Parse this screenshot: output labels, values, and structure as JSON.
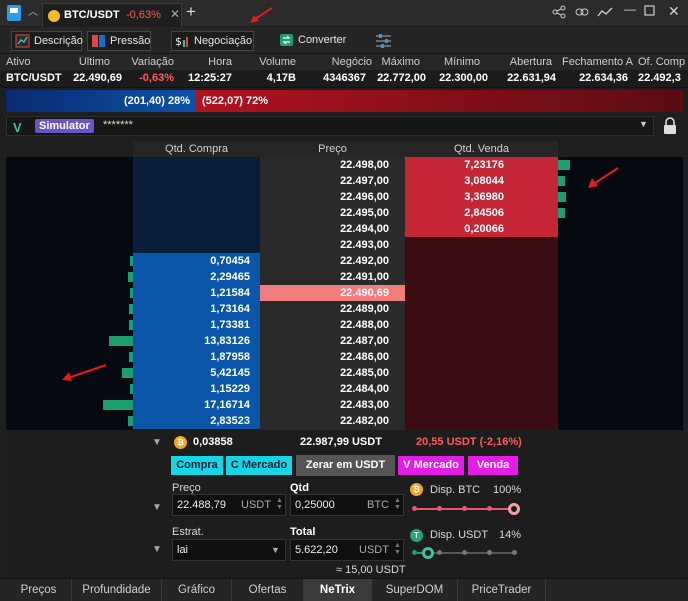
{
  "window": {
    "tab_symbol": "BTC/USDT",
    "tab_change": "-0,63%",
    "close_tab": "✕",
    "new_tab": "+"
  },
  "toolbar": {
    "descricao": "Descrição",
    "pressao": "Pressão",
    "negociacao": "Negociação",
    "converter": "Converter"
  },
  "quote": {
    "headers": [
      "Ativo",
      "Último",
      "Variação",
      "Hora",
      "Volume",
      "Negócio",
      "Máximo",
      "Mínimo",
      "Abertura",
      "Fechamento A",
      "Of. Comp"
    ],
    "values": [
      "BTC/USDT",
      "22.490,69",
      "-0,63%",
      "12:25:27",
      "4,17B",
      "4346367",
      "22.772,00",
      "22.300,00",
      "22.631,94",
      "22.634,36",
      "22.492,3"
    ]
  },
  "pressure": {
    "buy_label": "(201,40) 28%",
    "sell_label": "(522,07) 72%",
    "buy_fraction": 0.28
  },
  "account": {
    "mode": "Simulator",
    "masked": "*******"
  },
  "book": {
    "headers": {
      "buy": "Qtd. Compra",
      "price": "Preço",
      "sell": "Qtd. Venda"
    },
    "sell_rows": [
      {
        "price": "22.498,00",
        "qty": "7,23176",
        "vol": 0.55
      },
      {
        "price": "22.497,00",
        "qty": "3,08044",
        "vol": 0.3
      },
      {
        "price": "22.496,00",
        "qty": "3,36980",
        "vol": 0.35
      },
      {
        "price": "22.495,00",
        "qty": "2,84506",
        "vol": 0.3
      },
      {
        "price": "22.494,00",
        "qty": "0,20066",
        "vol": 0
      }
    ],
    "mid_price": "22.493,00",
    "buy_rows": [
      {
        "price": "22.492,00",
        "qty": "0,70454",
        "vol": 0.1
      },
      {
        "price": "22.491,00",
        "qty": "2,29465",
        "vol": 0.15
      },
      {
        "price": "22.490,69",
        "qty": "1,21584",
        "vol": 0.1,
        "current": true
      },
      {
        "price": "22.489,00",
        "qty": "1,73164",
        "vol": 0.12
      },
      {
        "price": "22.488,00",
        "qty": "1,73381",
        "vol": 0.12
      },
      {
        "price": "22.487,00",
        "qty": "13,83126",
        "vol": 0.8
      },
      {
        "price": "22.486,00",
        "qty": "1,87958",
        "vol": 0.12
      },
      {
        "price": "22.485,00",
        "qty": "5,42145",
        "vol": 0.35
      },
      {
        "price": "22.484,00",
        "qty": "1,15229",
        "vol": 0.1
      },
      {
        "price": "22.483,00",
        "qty": "17,16714",
        "vol": 1.0
      },
      {
        "price": "22.482,00",
        "qty": "2,83523",
        "vol": 0.18
      }
    ]
  },
  "order": {
    "balance": "0,03858",
    "ref_price": "22.987,99 USDT",
    "change": "20,55 USDT (-2,16%)",
    "buttons": {
      "compra": "Compra",
      "c_mercado": "C Mercado",
      "zerar": "Zerar em USDT",
      "v_mercado": "V Mercado",
      "venda": "Venda"
    },
    "preco_label": "Preço",
    "preco_value": "22.488,79",
    "preco_unit": "USDT",
    "qtd_label": "Qtd",
    "qtd_value": "0,25000",
    "qtd_unit": "BTC",
    "estrat_label": "Estrat.",
    "estrat_value": "lai",
    "total_label": "Total",
    "total_value": "5.622,20",
    "total_unit": "USDT",
    "approx": "≈ 15,00 USDT",
    "disp_btc_label": "Disp. BTC",
    "disp_btc_pct": "100%",
    "disp_btc_fraction": 1.0,
    "disp_usdt_label": "Disp. USDT",
    "disp_usdt_pct": "14%",
    "disp_usdt_fraction": 0.14
  },
  "bottom_tabs": [
    "Preços",
    "Profundidade",
    "Gráfico",
    "Ofertas",
    "NeTrix",
    "SuperDOM",
    "PriceTrader"
  ],
  "active_tab": "NeTrix",
  "colors": {
    "buy": "#0b56a8",
    "sell": "#c52636",
    "accent": "#3ec1a4"
  }
}
